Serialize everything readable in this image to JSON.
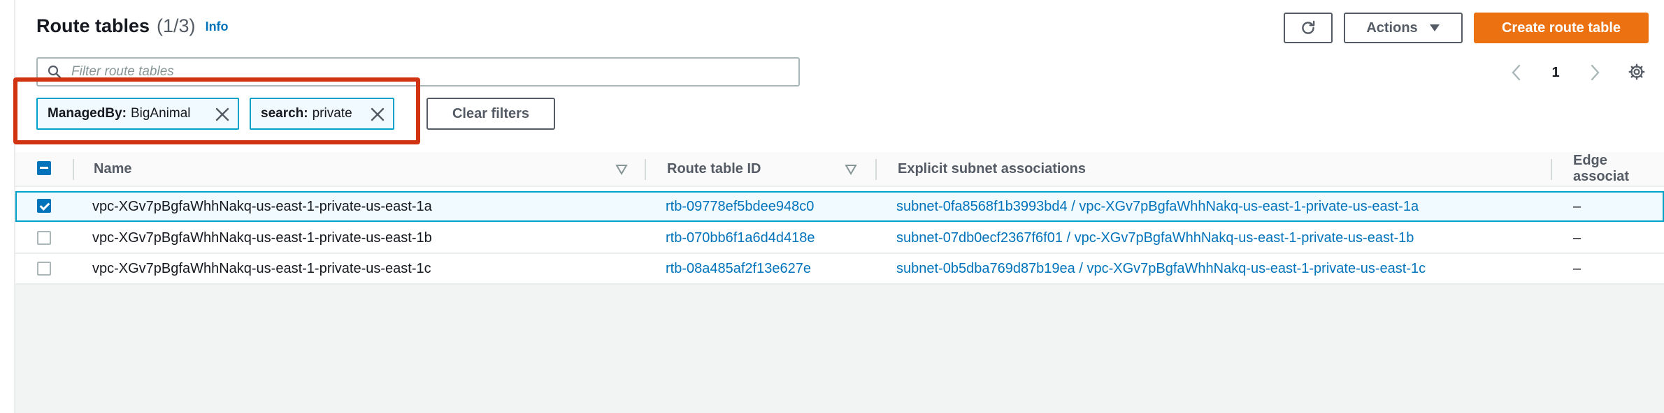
{
  "header": {
    "title": "Route tables",
    "count": "(1/3)",
    "info_link": "Info",
    "actions_label": "Actions",
    "create_label": "Create route table"
  },
  "search": {
    "placeholder": "Filter route tables",
    "value": ""
  },
  "pagination": {
    "current_page": "1"
  },
  "filters": {
    "tokens": [
      {
        "key": "ManagedBy:",
        "value": "BigAnimal"
      },
      {
        "key": "search:",
        "value": "private"
      }
    ],
    "clear_label": "Clear filters"
  },
  "table": {
    "columns": [
      "Name",
      "Route table ID",
      "Explicit subnet associations",
      "Edge associat"
    ],
    "rows": [
      {
        "selected": true,
        "name": "vpc-XGv7pBgfaWhhNakq-us-east-1-private-us-east-1a",
        "route_table_id": "rtb-09778ef5bdee948c0",
        "subnet_assoc": "subnet-0fa8568f1b3993bd4 / vpc-XGv7pBgfaWhhNakq-us-east-1-private-us-east-1a",
        "edge": "–"
      },
      {
        "selected": false,
        "name": "vpc-XGv7pBgfaWhhNakq-us-east-1-private-us-east-1b",
        "route_table_id": "rtb-070bb6f1a6d4d418e",
        "subnet_assoc": "subnet-07db0ecf2367f6f01 / vpc-XGv7pBgfaWhhNakq-us-east-1-private-us-east-1b",
        "edge": "–"
      },
      {
        "selected": false,
        "name": "vpc-XGv7pBgfaWhhNakq-us-east-1-private-us-east-1c",
        "route_table_id": "rtb-08a485af2f13e627e",
        "subnet_assoc": "subnet-0b5dba769d87b19ea / vpc-XGv7pBgfaWhhNakq-us-east-1-private-us-east-1c",
        "edge": "–"
      }
    ]
  },
  "colors": {
    "accent": "#ec7211",
    "link": "#0073bb",
    "highlight": "#d13212"
  }
}
